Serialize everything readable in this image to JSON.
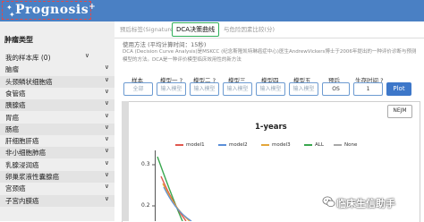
{
  "app": {
    "logo_text": "Prognosis",
    "logo_plus": "+"
  },
  "sidebar": {
    "title": "肿瘤类型",
    "items": [
      {
        "label": "我的样本库 (0)",
        "highlight": false
      },
      {
        "label": "脑瘤",
        "highlight": false
      },
      {
        "label": "头颈鳞状细胞癌",
        "highlight": true
      },
      {
        "label": "食管癌",
        "highlight": false
      },
      {
        "label": "胰腺癌",
        "highlight": true
      },
      {
        "label": "胃癌",
        "highlight": false
      },
      {
        "label": "肠癌",
        "highlight": true
      },
      {
        "label": "肝细胞肝癌",
        "highlight": false
      },
      {
        "label": "非小细胞肺癌",
        "highlight": true
      },
      {
        "label": "乳腺浸润癌",
        "highlight": false
      },
      {
        "label": "卵巢浆液性囊腺癌",
        "highlight": true
      },
      {
        "label": "宫颈癌",
        "highlight": false
      },
      {
        "label": "子宫内膜癌",
        "highlight": true
      }
    ],
    "arrow": "∨"
  },
  "tabs": [
    {
      "label": "预后标签(Signature)",
      "active": false
    },
    {
      "label": "DCA决策曲线",
      "active": true
    },
    {
      "label": "与危险因素比较(分)",
      "active": false
    }
  ],
  "method_text": "使用方法 (平均计算时间：15秒)",
  "description": "DCA (Decision Curve Analysis)是MSKCC (纪念斯隆凯特琳癌症中心)医生AndrewVickers博士于2006年提出的一种评价诊断与预测模型的方法。DCA是一种评价模型临床效用性的新方法",
  "form": {
    "fields": [
      {
        "label": "样本",
        "placeholder": "全部"
      },
      {
        "label": "模型一 ?",
        "placeholder": "输入模型"
      },
      {
        "label": "模型二 ?",
        "placeholder": "输入模型"
      },
      {
        "label": "模型三",
        "placeholder": "输入模型"
      },
      {
        "label": "模型四",
        "placeholder": "输入模型"
      },
      {
        "label": "模型五",
        "placeholder": "输入模型"
      },
      {
        "label": "预后",
        "value": "OS"
      },
      {
        "label": "生存时间 ?",
        "value": "1"
      }
    ],
    "plot_button": "Plot"
  },
  "chart": {
    "export_button": "NEJM",
    "title": "1-years",
    "y_ticks": [
      "0.3",
      "0.2"
    ]
  },
  "chart_data": {
    "type": "line",
    "title": "1-years",
    "series": [
      {
        "name": "model1",
        "color": "#e0584f"
      },
      {
        "name": "model2",
        "color": "#5b8fd8"
      },
      {
        "name": "model3",
        "color": "#e3a63a"
      },
      {
        "name": "ALL",
        "color": "#3aa74f"
      },
      {
        "name": "None",
        "color": "#a8a8a8"
      }
    ],
    "y_ticks": [
      0.3,
      0.2
    ]
  },
  "watermark": {
    "text": "临床生信助手",
    "icon": "wechat-icon"
  }
}
